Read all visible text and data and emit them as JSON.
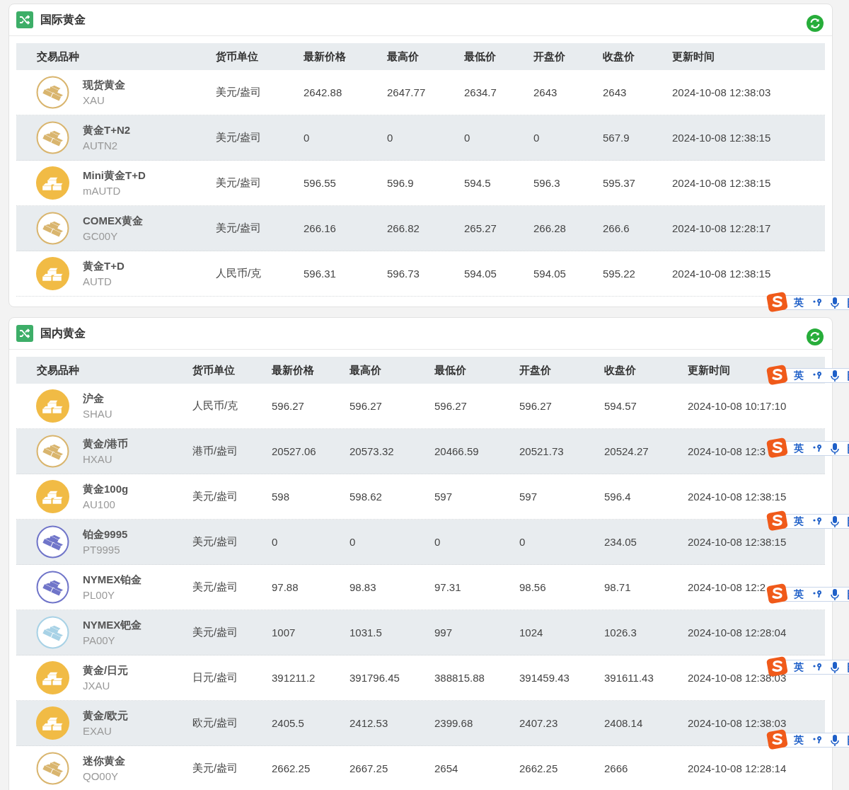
{
  "panels": [
    {
      "title": "国际黄金",
      "product_column": "交易品种",
      "columns": [
        "货币单位",
        "最新价格",
        "最高价",
        "最低价",
        "开盘价",
        "收盘价",
        "更新时间"
      ],
      "rows": [
        {
          "name": "现货黄金",
          "code": "XAU",
          "icon": {
            "kind": "outline",
            "color": "#d9b56e"
          },
          "cells": [
            "美元/盎司",
            "2642.88",
            "2647.77",
            "2634.7",
            "2643",
            "2643",
            "2024-10-08 12:38:03"
          ]
        },
        {
          "name": "黄金T+N2",
          "code": "AUTN2",
          "icon": {
            "kind": "outline",
            "color": "#d9b56e"
          },
          "cells": [
            "美元/盎司",
            "0",
            "0",
            "0",
            "0",
            "567.9",
            "2024-10-08 12:38:15"
          ]
        },
        {
          "name": "Mini黄金T+D",
          "code": "mAUTD",
          "icon": {
            "kind": "filled",
            "color": "#f1bb45"
          },
          "cells": [
            "美元/盎司",
            "596.55",
            "596.9",
            "594.5",
            "596.3",
            "595.37",
            "2024-10-08 12:38:15"
          ]
        },
        {
          "name": "COMEX黄金",
          "code": "GC00Y",
          "icon": {
            "kind": "outline",
            "color": "#d9b56e"
          },
          "cells": [
            "美元/盎司",
            "266.16",
            "266.82",
            "265.27",
            "266.28",
            "266.6",
            "2024-10-08 12:28:17"
          ]
        },
        {
          "name": "黄金T+D",
          "code": "AUTD",
          "icon": {
            "kind": "filled",
            "color": "#f1bb45"
          },
          "cells": [
            "人民币/克",
            "596.31",
            "596.73",
            "594.05",
            "594.05",
            "595.22",
            "2024-10-08 12:38:15"
          ]
        }
      ]
    },
    {
      "title": "国内黄金",
      "product_column": "交易品种",
      "columns": [
        "货币单位",
        "最新价格",
        "最高价",
        "最低价",
        "开盘价",
        "收盘价",
        "更新时间"
      ],
      "rows": [
        {
          "name": "沪金",
          "code": "SHAU",
          "icon": {
            "kind": "filled",
            "color": "#f1bb45"
          },
          "cells": [
            "人民币/克",
            "596.27",
            "596.27",
            "596.27",
            "596.27",
            "594.57",
            "2024-10-08 10:17:10"
          ]
        },
        {
          "name": "黄金/港币",
          "code": "HXAU",
          "icon": {
            "kind": "outline",
            "color": "#d9b56e"
          },
          "cells": [
            "港币/盎司",
            "20527.06",
            "20573.32",
            "20466.59",
            "20521.73",
            "20524.27",
            "2024-10-08 12:3"
          ]
        },
        {
          "name": "黄金100g",
          "code": "AU100",
          "icon": {
            "kind": "filled",
            "color": "#f1bb45"
          },
          "cells": [
            "美元/盎司",
            "598",
            "598.62",
            "597",
            "597",
            "596.4",
            "2024-10-08 12:38:15"
          ]
        },
        {
          "name": "铂金9995",
          "code": "PT9995",
          "icon": {
            "kind": "outline",
            "color": "#7075c9"
          },
          "cells": [
            "美元/盎司",
            "0",
            "0",
            "0",
            "0",
            "234.05",
            "2024-10-08 12:38:15"
          ]
        },
        {
          "name": "NYMEX铂金",
          "code": "PL00Y",
          "icon": {
            "kind": "outline",
            "color": "#7075c9"
          },
          "cells": [
            "美元/盎司",
            "97.88",
            "98.83",
            "97.31",
            "98.56",
            "98.71",
            "2024-10-08 12:2"
          ]
        },
        {
          "name": "NYMEX钯金",
          "code": "PA00Y",
          "icon": {
            "kind": "outline",
            "color": "#a8d2e6"
          },
          "cells": [
            "美元/盎司",
            "1007",
            "1031.5",
            "997",
            "1024",
            "1026.3",
            "2024-10-08 12:28:04"
          ]
        },
        {
          "name": "黄金/日元",
          "code": "JXAU",
          "icon": {
            "kind": "filled",
            "color": "#f1bb45"
          },
          "cells": [
            "日元/盎司",
            "391211.2",
            "391796.45",
            "388815.88",
            "391459.43",
            "391611.43",
            "2024-10-08 12:38:03"
          ]
        },
        {
          "name": "黄金/欧元",
          "code": "EXAU",
          "icon": {
            "kind": "filled",
            "color": "#f1bb45"
          },
          "cells": [
            "欧元/盎司",
            "2405.5",
            "2412.53",
            "2399.68",
            "2407.23",
            "2408.14",
            "2024-10-08 12:38:03"
          ]
        },
        {
          "name": "迷你黄金",
          "code": "QO00Y",
          "icon": {
            "kind": "outline",
            "color": "#d9b56e"
          },
          "cells": [
            "美元/盎司",
            "2662.25",
            "2667.25",
            "2654",
            "2662.25",
            "2666",
            "2024-10-08 12:28:14"
          ]
        }
      ]
    }
  ],
  "ime_toolbars": [
    {
      "label": "英"
    },
    {
      "label": "英"
    },
    {
      "label": "英"
    },
    {
      "label": "英"
    },
    {
      "label": "英"
    },
    {
      "label": "英"
    },
    {
      "label": "英"
    }
  ]
}
